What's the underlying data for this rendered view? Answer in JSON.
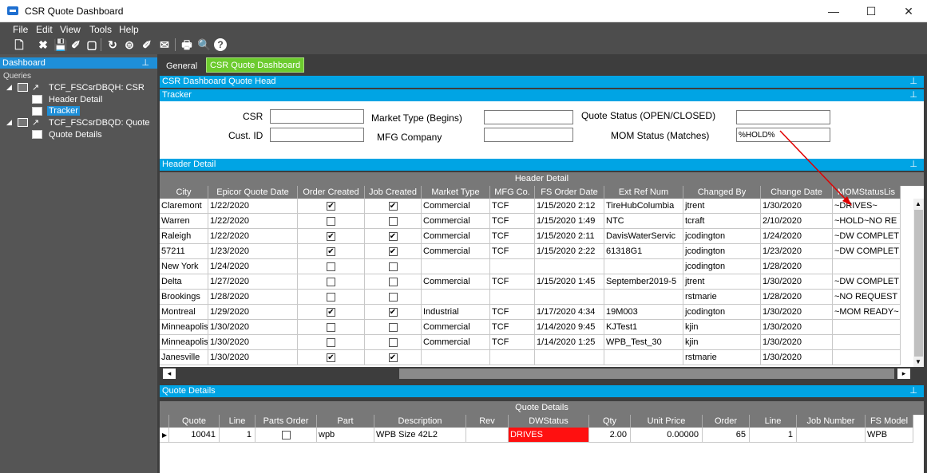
{
  "window": {
    "title": "CSR Quote Dashboard",
    "min_glyph": "—",
    "max_glyph": "☐",
    "close_glyph": "✕"
  },
  "menu": [
    "File",
    "Edit",
    "View",
    "Tools",
    "Help"
  ],
  "toolbar_icons": [
    "new-icon",
    "delete-icon",
    "save-icon",
    "clear-icon",
    "undo-icon",
    "refresh-icon",
    "options-icon",
    "broom-icon",
    "message-icon",
    "print-icon",
    "preview-icon",
    "help-icon"
  ],
  "toolbar_glyphs": [
    "🗋",
    "✖",
    "💾",
    "✐",
    "▢",
    "↻",
    "⊜",
    "✐",
    "✉",
    "🖶",
    "🔍",
    "?"
  ],
  "left": {
    "title": "Dashboard",
    "pin": "⊥",
    "queries": "Queries",
    "tree": [
      {
        "label": "TCF_FSCsrDBQH: CSR"
      },
      {
        "label": "Header Detail"
      },
      {
        "label": "Tracker"
      },
      {
        "label": "TCF_FSCsrDBQD: Quote"
      },
      {
        "label": "Quote Details"
      }
    ]
  },
  "tabs": {
    "general": "General",
    "dashboard": "CSR Quote Dashboard"
  },
  "panels": {
    "head": "CSR Dashboard Quote Head",
    "tracker": "Tracker",
    "header_detail": "Header Detail",
    "quote_details": "Quote Details",
    "pin": "⊥"
  },
  "tracker": {
    "csr_label": "CSR",
    "custid_label": "Cust. ID",
    "market_label": "Market Type (Begins)",
    "mfg_label": "MFG Company",
    "quote_status_label": "Quote Status (OPEN/CLOSED)",
    "mom_label": "MOM Status (Matches)",
    "mom_value": "%HOLD%"
  },
  "grid1": {
    "title": "Header Detail",
    "columns": [
      "City",
      "Epicor Quote Date",
      "Order Created",
      "Job Created",
      "Market Type",
      "MFG Co.",
      "FS Order Date",
      "Ext Ref Num",
      "Changed By",
      "Change Date",
      "MOMStatusLis"
    ],
    "rows": [
      [
        "Claremont",
        "1/22/2020",
        true,
        true,
        "Commercial",
        "TCF",
        "1/15/2020 2:12",
        "TireHubColumbia",
        "jtrent",
        "1/30/2020",
        "~DRIVES~"
      ],
      [
        "Warren",
        "1/22/2020",
        false,
        false,
        "Commercial",
        "TCF",
        "1/15/2020 1:49",
        "NTC",
        "tcraft",
        "2/10/2020",
        "~HOLD~NO RE"
      ],
      [
        "Raleigh",
        "1/22/2020",
        true,
        true,
        "Commercial",
        "TCF",
        "1/15/2020 2:11",
        "DavisWaterServic",
        "jcodington",
        "1/24/2020",
        "~DW COMPLET"
      ],
      [
        "57211",
        "1/23/2020",
        true,
        true,
        "Commercial",
        "TCF",
        "1/15/2020 2:22",
        "61318G1",
        "jcodington",
        "1/23/2020",
        "~DW COMPLET"
      ],
      [
        "New York",
        "1/24/2020",
        false,
        false,
        "",
        "",
        "",
        "",
        "jcodington",
        "1/28/2020",
        ""
      ],
      [
        "Delta",
        "1/27/2020",
        false,
        false,
        "Commercial",
        "TCF",
        "1/15/2020 1:45",
        "September2019-5",
        "jtrent",
        "1/30/2020",
        "~DW COMPLET"
      ],
      [
        "Brookings",
        "1/28/2020",
        false,
        false,
        "",
        "",
        "",
        "",
        "rstmarie",
        "1/28/2020",
        "~NO REQUEST"
      ],
      [
        "Montreal",
        "1/29/2020",
        true,
        true,
        "Industrial",
        "TCF",
        "1/17/2020 4:34",
        "19M003",
        "jcodington",
        "1/30/2020",
        "~MOM READY~"
      ],
      [
        "Minneapolis",
        "1/30/2020",
        false,
        false,
        "Commercial",
        "TCF",
        "1/14/2020 9:45",
        "KJTest1",
        "kjin",
        "1/30/2020",
        ""
      ],
      [
        "Minneapolis",
        "1/30/2020",
        false,
        false,
        "Commercial",
        "TCF",
        "1/14/2020 1:25",
        "WPB_Test_30",
        "kjin",
        "1/30/2020",
        ""
      ],
      [
        "Janesville",
        "1/30/2020",
        true,
        true,
        "",
        "",
        "",
        "",
        "rstmarie",
        "1/30/2020",
        ""
      ]
    ]
  },
  "grid2": {
    "title": "Quote Details",
    "columns": [
      "Quote",
      "Line",
      "Parts Order",
      "Part",
      "Description",
      "Rev",
      "DWStatus",
      "Qty",
      "Unit Price",
      "Order",
      "Line",
      "Job Number",
      "FS Model"
    ],
    "row": [
      "10041",
      "1",
      false,
      "wpb",
      "WPB Size 42L2",
      "",
      "DRIVES",
      "2.00",
      "0.00000",
      "65",
      "1",
      "",
      "WPB"
    ],
    "status_color": "#ff1010"
  },
  "colors": {
    "accent": "#00a4e4",
    "tab_active": "#6ccb2e",
    "arrow": "#e00000"
  }
}
